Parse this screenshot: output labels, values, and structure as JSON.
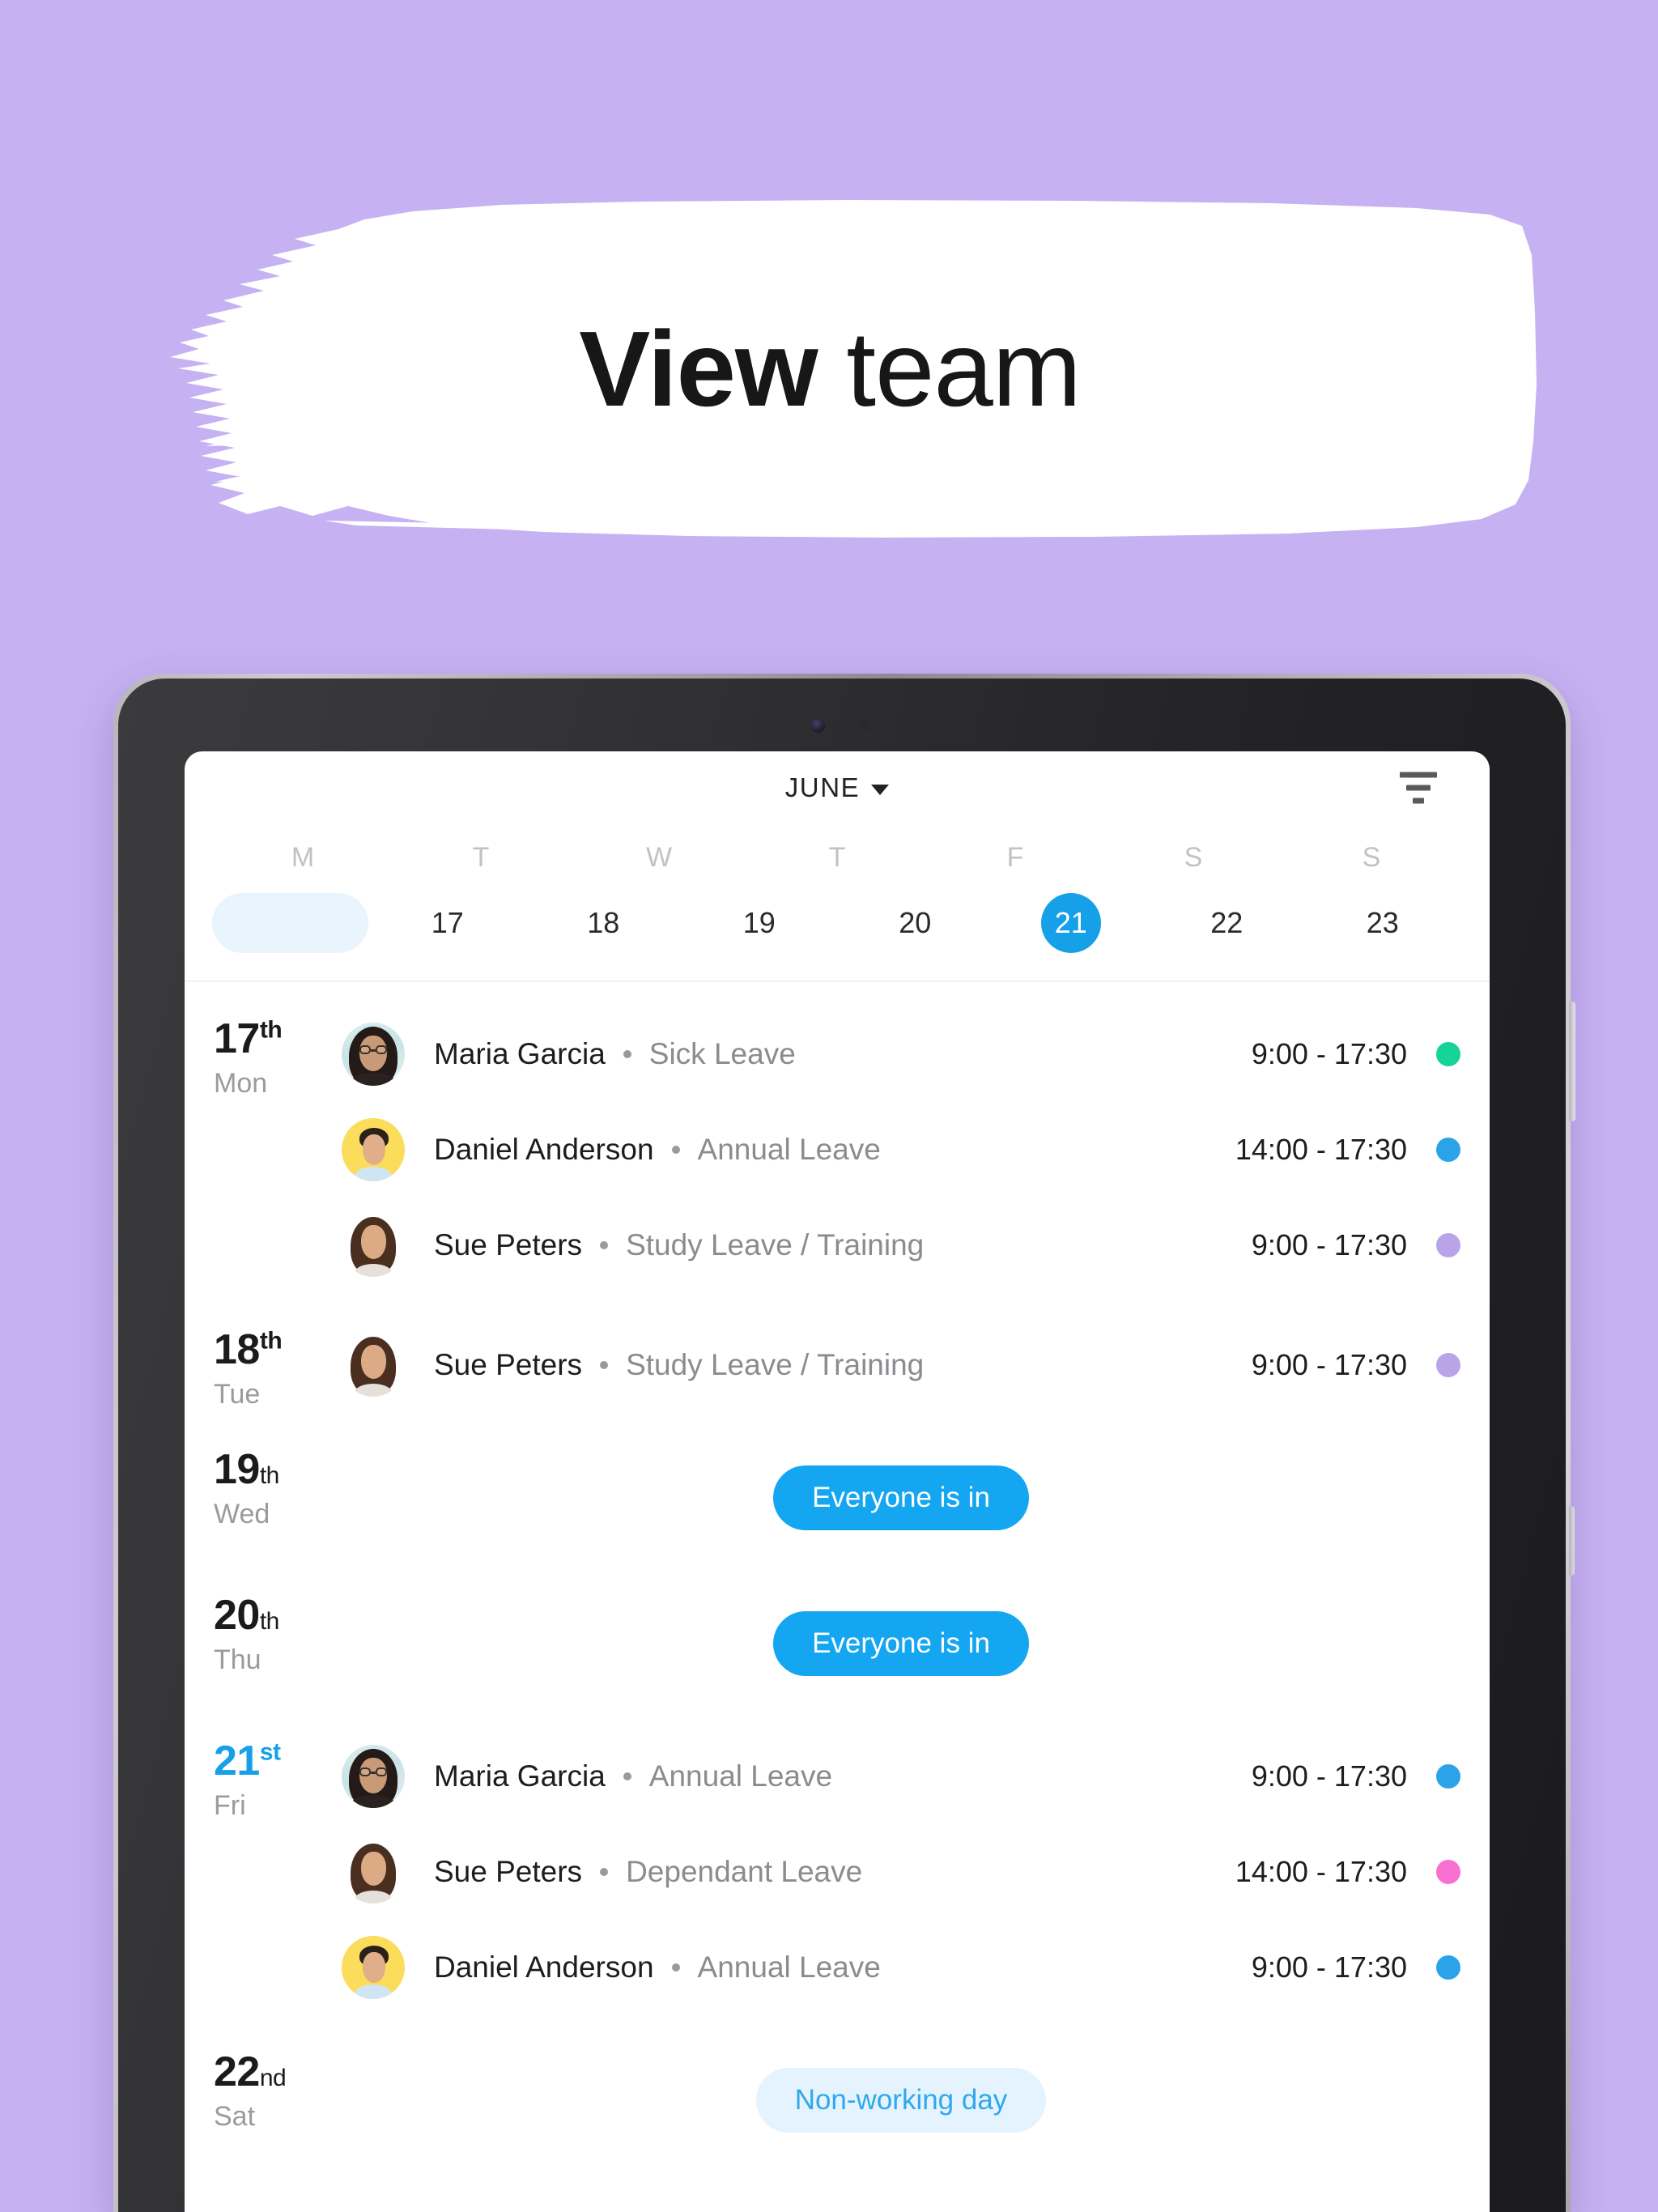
{
  "headline": {
    "bold": "View",
    "light": " team"
  },
  "theme": {
    "background": "#C6B2F2",
    "accent_blue": "#16A0E8",
    "pill_blue": "#14A6F0",
    "pill_muted_bg": "#E4F3FD",
    "weekend_pill_bg": "#E9F5FD"
  },
  "app": {
    "header": {
      "month": "JUNE",
      "caret_icon": "chevron-down-icon",
      "filter_icon": "filter-icon"
    },
    "week": {
      "day_initials": [
        "M",
        "T",
        "W",
        "T",
        "S",
        "S"
      ],
      "dow_labels": [
        "M",
        "T",
        "W",
        "T",
        "F",
        "S",
        "S"
      ],
      "dates": [
        "17",
        "18",
        "19",
        "20",
        "21",
        "22",
        "23"
      ],
      "today": "21",
      "weekend": [
        "22",
        "23"
      ]
    },
    "days": [
      {
        "num": "17",
        "suffix": "th",
        "suffix_style": "sup",
        "dow": "Mon",
        "is_today": false,
        "entries": [
          {
            "avatar": "avatar-maria-garcia",
            "name": "Maria Garcia",
            "type": "Sick Leave",
            "time": "9:00 - 17:30",
            "dot_color": "#16D397"
          },
          {
            "avatar": "avatar-daniel-anderson",
            "name": "Daniel Anderson",
            "type": "Annual Leave",
            "time": "14:00 - 17:30",
            "dot_color": "#2BA3E8"
          },
          {
            "avatar": "avatar-sue-peters",
            "name": "Sue Peters",
            "type": "Study Leave / Training",
            "time": "9:00 - 17:30",
            "dot_color": "#B9A4E8"
          }
        ]
      },
      {
        "num": "18",
        "suffix": "th",
        "suffix_style": "sup",
        "dow": "Tue",
        "is_today": false,
        "entries": [
          {
            "avatar": "avatar-sue-peters",
            "name": "Sue Peters",
            "type": "Study Leave / Training",
            "time": "9:00 - 17:30",
            "dot_color": "#B9A4E8"
          }
        ]
      },
      {
        "num": "19",
        "suffix": "th",
        "suffix_style": "sub",
        "dow": "Wed",
        "is_today": false,
        "badge": {
          "label": "Everyone is in",
          "style": "primary"
        },
        "entries": []
      },
      {
        "num": "20",
        "suffix": "th",
        "suffix_style": "sub",
        "dow": "Thu",
        "is_today": false,
        "badge": {
          "label": "Everyone is in",
          "style": "primary"
        },
        "entries": []
      },
      {
        "num": "21",
        "suffix": "st",
        "suffix_style": "sup",
        "dow": "Fri",
        "is_today": true,
        "entries": [
          {
            "avatar": "avatar-maria-garcia",
            "name": "Maria Garcia",
            "type": "Annual Leave",
            "time": "9:00 - 17:30",
            "dot_color": "#2BA3E8"
          },
          {
            "avatar": "avatar-sue-peters",
            "name": "Sue Peters",
            "type": "Dependant Leave",
            "time": "14:00 - 17:30",
            "dot_color": "#F971D0"
          },
          {
            "avatar": "avatar-daniel-anderson",
            "name": "Daniel Anderson",
            "type": "Annual Leave",
            "time": "9:00 - 17:30",
            "dot_color": "#2BA3E8"
          }
        ]
      },
      {
        "num": "22",
        "suffix": "nd",
        "suffix_style": "sub",
        "dow": "Sat",
        "is_today": false,
        "badge": {
          "label": "Non-working day",
          "style": "muted"
        },
        "entries": []
      }
    ]
  }
}
